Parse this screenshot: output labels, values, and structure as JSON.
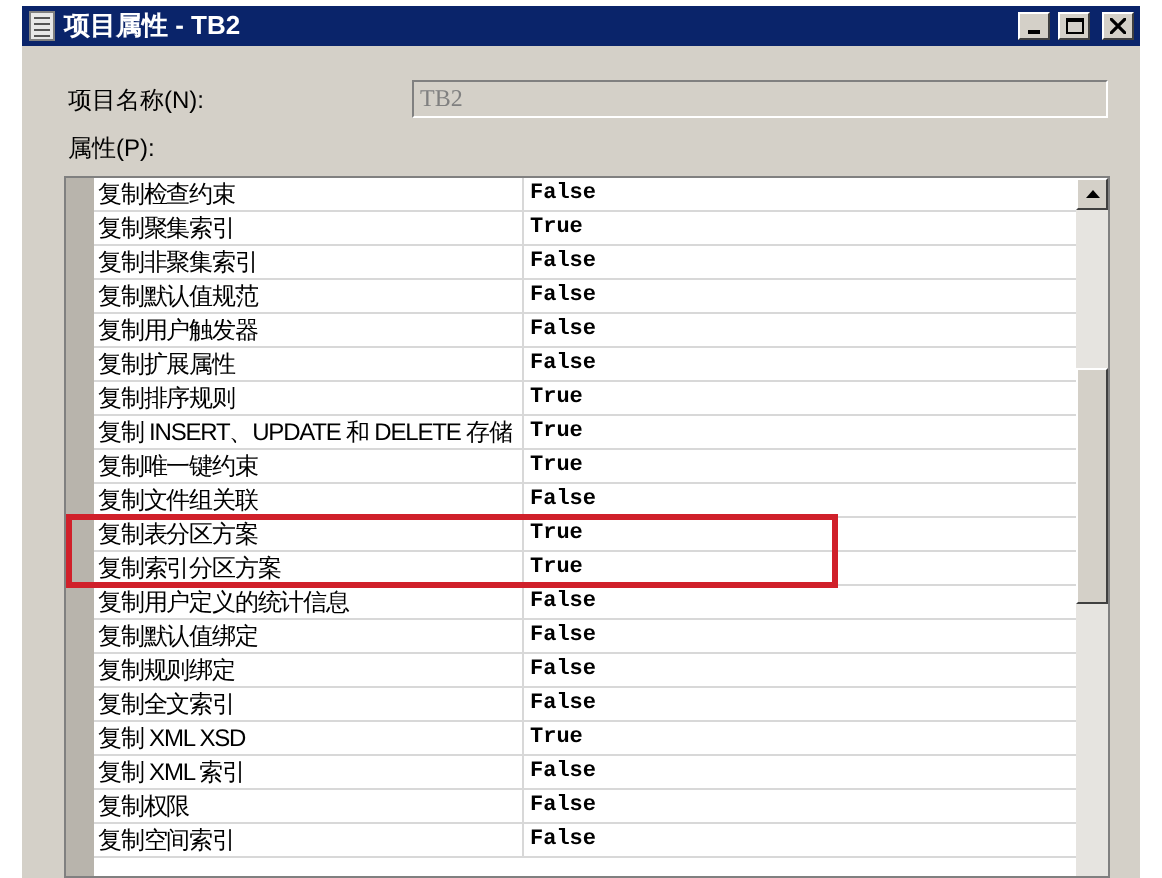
{
  "window": {
    "title": "项目属性 - TB2"
  },
  "name_field": {
    "label": "项目名称(N):",
    "value": "TB2",
    "disabled": true
  },
  "properties_label": "属性(P):",
  "properties": [
    {
      "name": "复制检查约束",
      "value": "False"
    },
    {
      "name": "复制聚集索引",
      "value": "True"
    },
    {
      "name": "复制非聚集索引",
      "value": "False"
    },
    {
      "name": "复制默认值规范",
      "value": "False"
    },
    {
      "name": "复制用户触发器",
      "value": "False"
    },
    {
      "name": "复制扩展属性",
      "value": "False"
    },
    {
      "name": "复制排序规则",
      "value": "True"
    },
    {
      "name": "复制 INSERT、UPDATE 和 DELETE 存储",
      "value": "True"
    },
    {
      "name": "复制唯一键约束",
      "value": "True"
    },
    {
      "name": "复制文件组关联",
      "value": "False"
    },
    {
      "name": "复制表分区方案",
      "value": "True"
    },
    {
      "name": "复制索引分区方案",
      "value": "True"
    },
    {
      "name": "复制用户定义的统计信息",
      "value": "False"
    },
    {
      "name": "复制默认值绑定",
      "value": "False"
    },
    {
      "name": "复制规则绑定",
      "value": "False"
    },
    {
      "name": "复制全文索引",
      "value": "False"
    },
    {
      "name": "复制 XML XSD",
      "value": "True"
    },
    {
      "name": "复制 XML 索引",
      "value": "False"
    },
    {
      "name": "复制权限",
      "value": "False"
    },
    {
      "name": "复制空间索引",
      "value": "False"
    }
  ]
}
